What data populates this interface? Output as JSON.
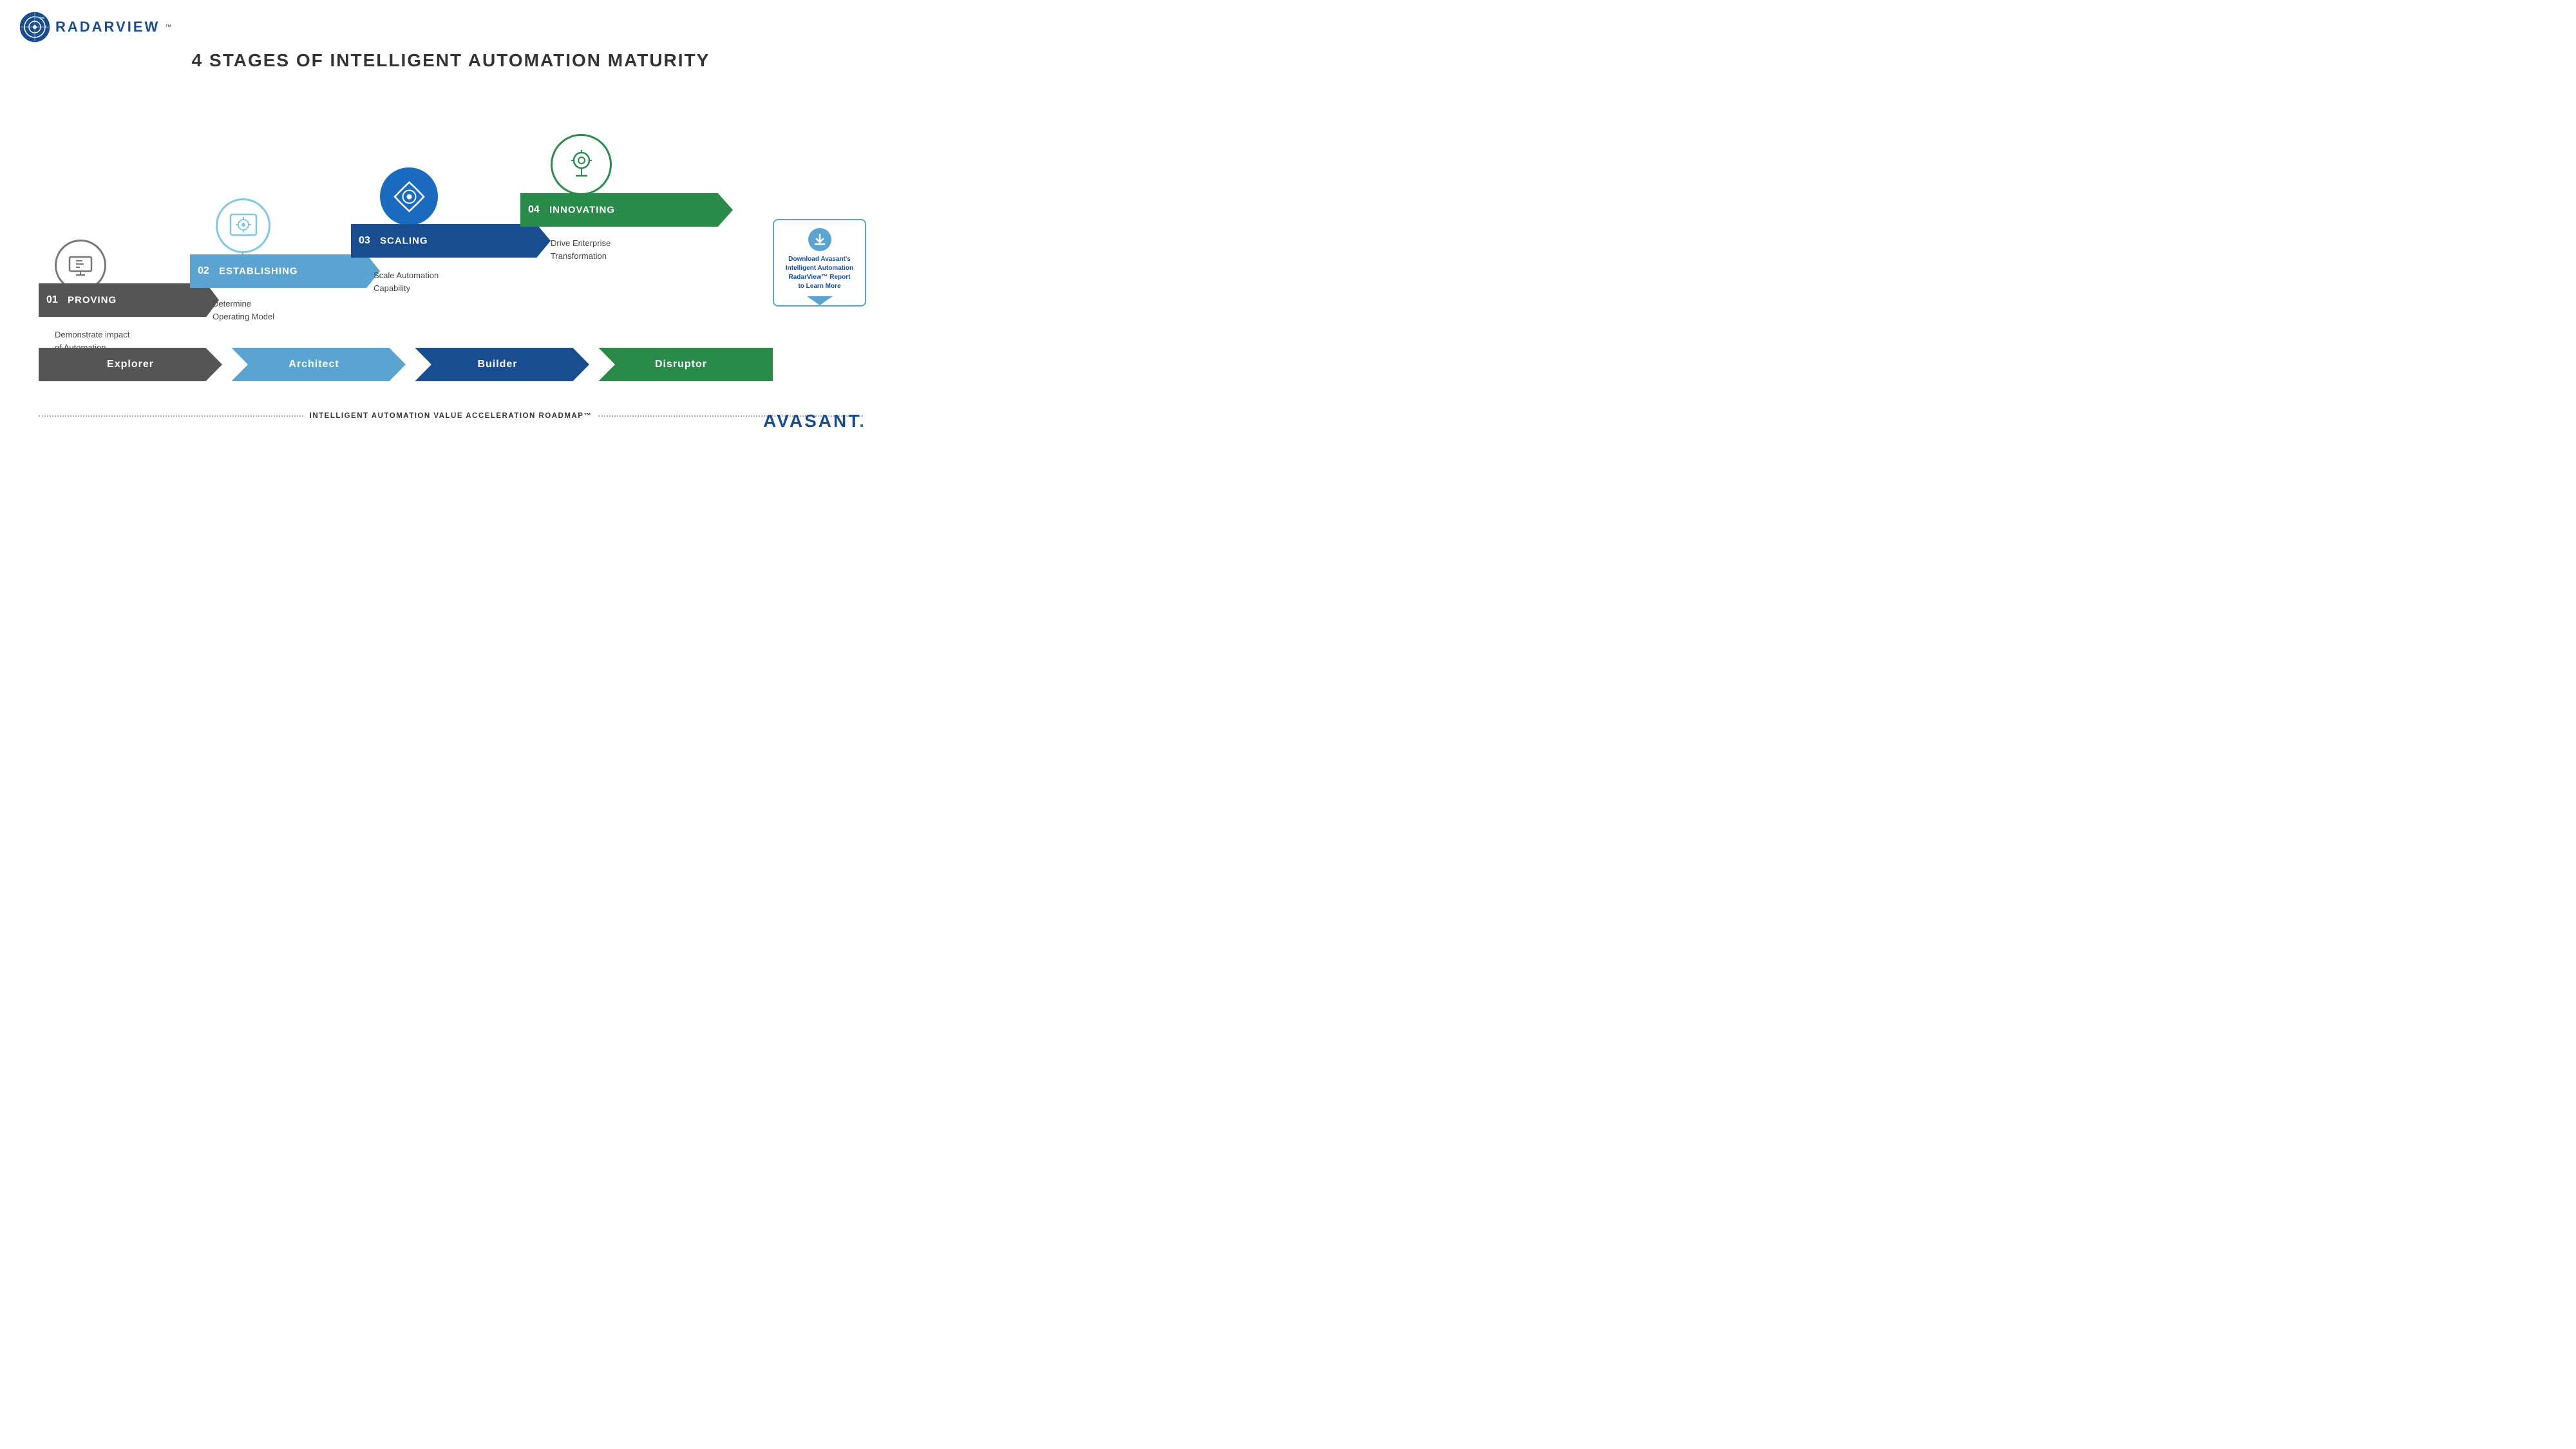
{
  "logo": {
    "text": "RADARVIEW",
    "tm": "™"
  },
  "main_title": "4 STAGES OF INTELLIGENT AUTOMATION MATURITY",
  "stages": [
    {
      "id": "01",
      "name": "PROVING",
      "description_line1": "Demonstrate impact",
      "description_line2": "of Automation",
      "color": "#555555",
      "chevron_color": "#555555"
    },
    {
      "id": "02",
      "name": "ESTABLISHING",
      "description_line1": "Determine",
      "description_line2": "Operating Model",
      "color": "#5ba3d0",
      "chevron_color": "#5ba3d0"
    },
    {
      "id": "03",
      "name": "SCALING",
      "description_line1": "Scale Automation",
      "description_line2": "Capability",
      "color": "#1a4d8f",
      "chevron_color": "#1a4d8f"
    },
    {
      "id": "04",
      "name": "INNOVATING",
      "description_line1": "Drive Enterprise",
      "description_line2": "Transformation",
      "color": "#2a8a4a",
      "chevron_color": "#2a8a4a"
    }
  ],
  "arrow_labels": [
    "Explorer",
    "Architect",
    "Builder",
    "Disruptor"
  ],
  "roadmap_text": "INTELLIGENT AUTOMATION VALUE ACCELERATION ROADMAP™",
  "download": {
    "line1": "Download Avasant's",
    "line2": "Intelligent Automation",
    "line3": "RadarView™ Report",
    "line4": "to Learn More"
  },
  "avasant": {
    "text": "AVASANT",
    "dot": "."
  }
}
